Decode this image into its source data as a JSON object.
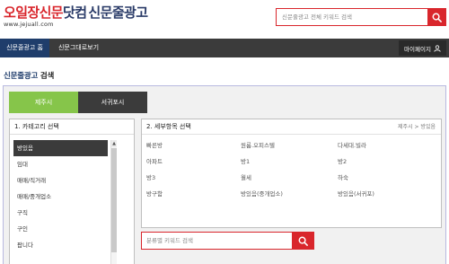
{
  "header": {
    "logo_part1": "오일장신문",
    "logo_part2": "닷컴",
    "logo_part3": "신문줄광고",
    "logo_url": "www.jejuall.com",
    "search_placeholder": "신문줄광고 전체 키워드 검색",
    "search_icon": "search-icon"
  },
  "nav": {
    "tabs": [
      {
        "label": "신문줄광고 홈",
        "active": true
      },
      {
        "label": "신문그대로보기",
        "active": false
      }
    ],
    "mypage_label": "마이페이지",
    "user_icon": "user-icon"
  },
  "page_title_part1": "신문줄광고",
  "page_title_part2": "검색",
  "regions": [
    "제주시",
    "서귀포시"
  ],
  "category": {
    "heading": "1. 카테고리 선택",
    "items": [
      "방있음",
      "임대",
      "매매/직거래",
      "매매/중개업소",
      "구직",
      "구인",
      "팝니다"
    ],
    "selected_index": 0
  },
  "detail": {
    "heading": "2. 세부항목 선택",
    "breadcrumb": "제주시 > 방있음",
    "items": [
      "빠른방",
      "원룸.오피스텔",
      "다세대.빌라",
      "아파트",
      "방1",
      "방2",
      "방3",
      "월세",
      "하숙",
      "방구함",
      "방있음(중개업소)",
      "방있음(서귀포)"
    ]
  },
  "category_search": {
    "placeholder": "분류별 키워드 검색",
    "search_icon": "search-icon"
  },
  "colors": {
    "brand_red": "#d9262c",
    "brand_navy": "#1f3d6b",
    "region_green": "#86c54a",
    "nav_dark": "#3b3b3b"
  }
}
